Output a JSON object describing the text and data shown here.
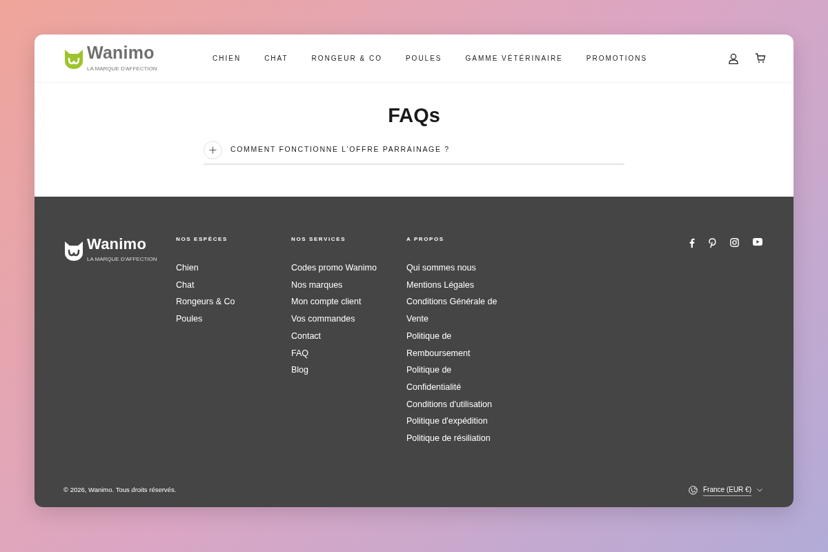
{
  "header": {
    "logo": {
      "name": "Wanimo",
      "tagline": "LA MARQUE D'AFFECTION"
    },
    "nav": [
      {
        "label": "CHIEN"
      },
      {
        "label": "CHAT"
      },
      {
        "label": "RONGEUR & CO"
      },
      {
        "label": "POULES"
      },
      {
        "label": "GAMME VÉTÉRINAIRE"
      },
      {
        "label": "PROMOTIONS"
      }
    ]
  },
  "faq": {
    "title": "FAQs",
    "items": [
      {
        "question": "COMMENT FONCTIONNE L’OFFRE PARRAINAGE ?",
        "expanded": false
      }
    ]
  },
  "footer": {
    "logo": {
      "name": "Wanimo",
      "tagline": "LA MARQUE D'AFFECTION"
    },
    "columns": [
      {
        "heading": "NOS ESPÈCES",
        "links": [
          "Chien",
          "Chat",
          "Rongeurs & Co",
          "Poules"
        ]
      },
      {
        "heading": "NOS SERVICES",
        "links": [
          "Codes promo Wanimo",
          "Nos marques",
          "Mon compte client",
          "Vos commandes",
          "Contact",
          "FAQ",
          "Blog"
        ]
      },
      {
        "heading": "A PROPOS",
        "links": [
          "Qui sommes nous",
          "Mentions Légales",
          "Conditions Générale de Vente",
          "Politique de Remboursement",
          "Politique de Confidentialité",
          "Conditions d'utilisation",
          "Politique d'expédition",
          "Politique de résiliation"
        ]
      }
    ],
    "copyright": "© 2026, Wanimo. Tous droits réservés.",
    "locale": "France (EUR €)"
  }
}
